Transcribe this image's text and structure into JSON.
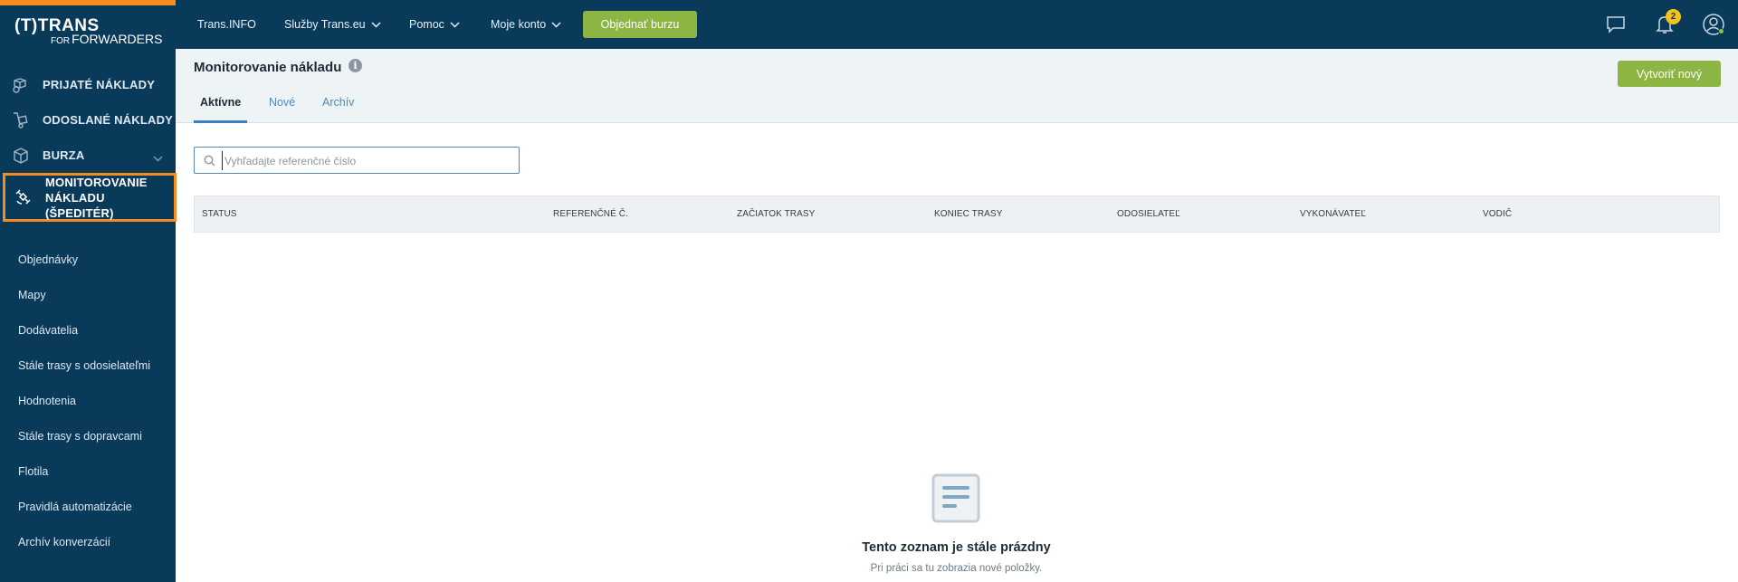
{
  "brand": {
    "logo_main": "(T)TRANS",
    "logo_for": "FOR",
    "logo_sub": "FORWARDERS"
  },
  "sidebar": {
    "main_items": [
      {
        "label": "PRIJATÉ NÁKLADY",
        "icon": "box-received-icon"
      },
      {
        "label": "ODOSLANÉ NÁKLADY",
        "icon": "hand-truck-icon"
      },
      {
        "label": "BURZA",
        "icon": "cube-icon"
      },
      {
        "label_line1": "MONITOROVANIE",
        "label_line2": "NÁKLADU (ŠPEDITÉR)",
        "icon": "satellite-icon",
        "active": true
      }
    ],
    "sub_items": [
      "Objednávky",
      "Mapy",
      "Dodávatelia",
      "Stále trasy s odosielateľmi",
      "Hodnotenia",
      "Stále trasy s dopravcami",
      "Flotila",
      "Pravidlá automatizácie",
      "Archív konverzácií"
    ]
  },
  "topbar": {
    "links": [
      "Trans.INFO",
      "Služby Trans.eu",
      "Pomoc",
      "Moje konto"
    ],
    "order_button": "Objednať burzu",
    "notification_count": "2",
    "icons": [
      "chat-icon",
      "bell-icon",
      "user-avatar-icon"
    ]
  },
  "page": {
    "title": "Monitorovanie nákladu",
    "info": "i",
    "create_button": "Vytvoriť nový",
    "tabs": [
      {
        "label": "Aktívne",
        "active": true
      },
      {
        "label": "Nové",
        "active": false
      },
      {
        "label": "Archív",
        "active": false
      }
    ],
    "search": {
      "placeholder": "Vyhľadajte referenčné číslo",
      "value": ""
    },
    "columns": [
      "STATUS",
      "REFERENČNÉ Č.",
      "ZAČIATOK TRASY",
      "KONIEC TRASY",
      "ODOSIELATEĽ",
      "VYKONÁVATEĽ",
      "VODIČ"
    ],
    "empty_title": "Tento zoznam je stále prázdny",
    "empty_subtitle": "Pri práci sa tu zobrazia nové položky."
  },
  "colors": {
    "navy": "#0a3a5a",
    "accent_orange": "#f68b1f",
    "button_green": "#8cb543",
    "badge_yellow": "#f6c31c",
    "link_blue": "#4a8bbd"
  }
}
